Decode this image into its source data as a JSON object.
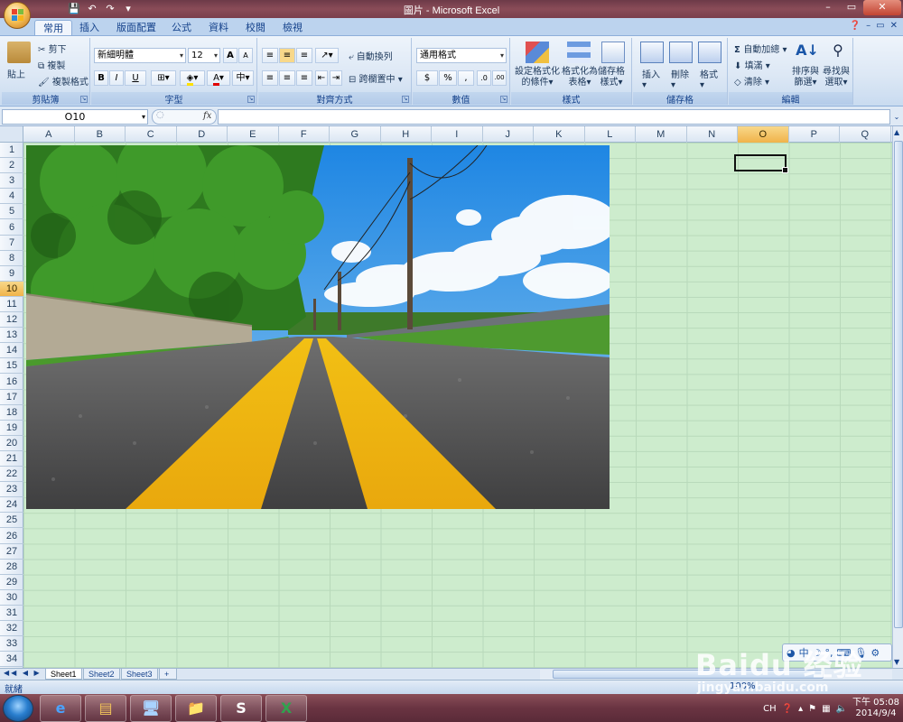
{
  "window": {
    "title": "圖片 - Microsoft Excel",
    "controls": [
      "–",
      "▭",
      "✕"
    ]
  },
  "quick_access": [
    "save-icon",
    "undo-icon",
    "redo-icon"
  ],
  "tabs": [
    "常用",
    "插入",
    "版面配置",
    "公式",
    "資料",
    "校閱",
    "檢視"
  ],
  "active_tab": "常用",
  "ribbon": {
    "clipboard": {
      "label": "剪貼簿",
      "paste": "貼上",
      "cut": "剪下",
      "copy": "複製",
      "format_painter": "複製格式"
    },
    "font": {
      "label": "字型",
      "font_name": "新細明體",
      "font_size": "12",
      "grow": "A",
      "shrink": "A",
      "bold": "B",
      "italic": "I",
      "underline": "U"
    },
    "alignment": {
      "label": "對齊方式",
      "wrap_text": "自動換列",
      "merge_center": "跨欄置中"
    },
    "number": {
      "label": "數值",
      "format": "通用格式",
      "currency": "$",
      "percent": "%",
      "comma": ",",
      "inc_decimal": ".0",
      "dec_decimal": ".00"
    },
    "styles": {
      "label": "樣式",
      "conditional": [
        "設定格式化",
        "的條件"
      ],
      "format_table": [
        "格式化為",
        "表格"
      ],
      "cell_styles": [
        "儲存格",
        "樣式"
      ]
    },
    "cells": {
      "label": "儲存格",
      "insert": "插入",
      "delete": "刪除",
      "format": "格式"
    },
    "editing": {
      "label": "編輯",
      "autosum": "自動加總",
      "fill": "填滿",
      "clear": "清除",
      "sort_filter": [
        "排序與",
        "篩選"
      ],
      "find_select": [
        "尋找與",
        "選取"
      ]
    }
  },
  "formula_bar": {
    "name_box": "O10",
    "fx": "fx",
    "value": ""
  },
  "columns": [
    "A",
    "B",
    "C",
    "D",
    "E",
    "F",
    "G",
    "H",
    "I",
    "J",
    "K",
    "L",
    "M",
    "N",
    "O",
    "P",
    "Q"
  ],
  "selected_column": "O",
  "rows": [
    "1",
    "2",
    "3",
    "4",
    "5",
    "6",
    "7",
    "8",
    "9",
    "10",
    "11",
    "12",
    "13",
    "14",
    "15",
    "16",
    "17",
    "18",
    "19",
    "20",
    "21",
    "22",
    "23",
    "24",
    "25",
    "26",
    "27",
    "28",
    "29",
    "30",
    "31",
    "32",
    "33",
    "34"
  ],
  "selected_row": "10",
  "sheets": [
    "Sheet1",
    "Sheet2",
    "Sheet3"
  ],
  "active_sheet": "Sheet1",
  "status": "就緒",
  "zoom": "100%",
  "taskbar": {
    "apps": [
      "ie-icon",
      "explorer-icon",
      "computer-icon",
      "folder-icon",
      "skype-icon",
      "excel-icon"
    ],
    "lang": "CH",
    "time": "下午 05:08",
    "date": "2014/9/4"
  },
  "watermark": {
    "brand": "Baidu 经验",
    "url": "jingyan.baidu.com"
  },
  "colors": {
    "grid_bg": "#cdeccd",
    "accent": "#15428b",
    "selection": "#f0b34a"
  }
}
